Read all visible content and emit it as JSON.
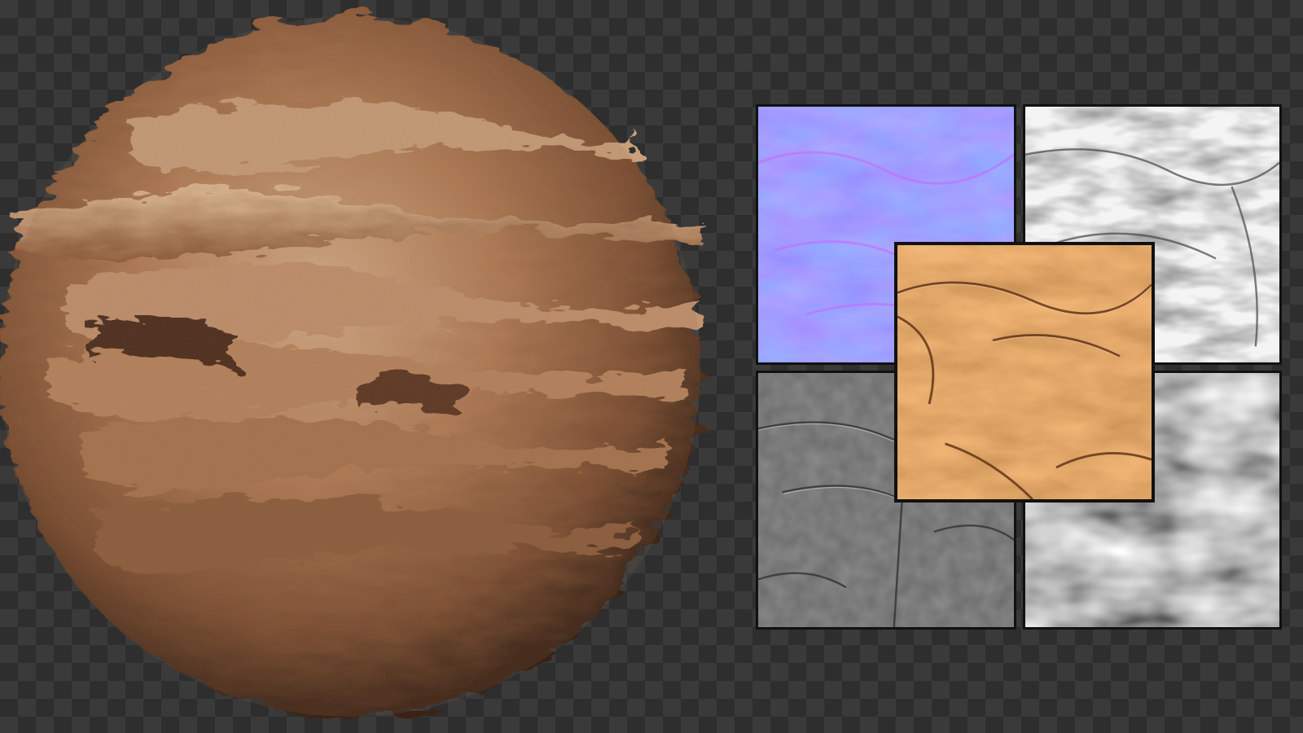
{
  "scene": {
    "background": "transparency-checkerboard",
    "colors": {
      "checker_light": "#3a3a3a",
      "checker_dark": "#2e2e2e",
      "tile_border": "#111111",
      "rock_base": "#9c6a48",
      "rock_highlight": "#d8b08c",
      "rock_shadow": "#3a2216",
      "normal_map": "#7f7fff",
      "albedo": "#c97a3e",
      "ao_map": "#f2f2f2",
      "height_map": "#8a8a8a",
      "roughness_map": "#7a7a7a"
    }
  },
  "preview": {
    "subject": "sandstone-rock-sphere"
  },
  "texture_maps": [
    {
      "id": "normal",
      "kind": "normal-map"
    },
    {
      "id": "ao",
      "kind": "ambient-occlusion-map"
    },
    {
      "id": "height",
      "kind": "height-map"
    },
    {
      "id": "roughness",
      "kind": "roughness-map"
    },
    {
      "id": "albedo",
      "kind": "albedo-map"
    }
  ]
}
